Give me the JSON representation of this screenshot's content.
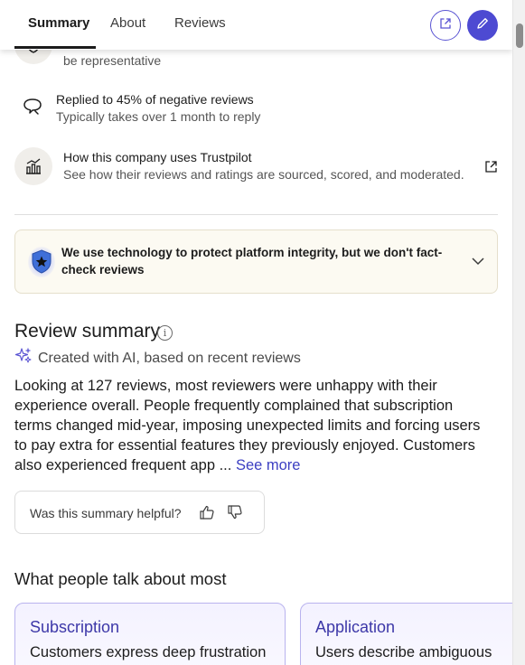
{
  "tabs": [
    {
      "label": "Summary",
      "active": true
    },
    {
      "label": "About",
      "active": false
    },
    {
      "label": "Reviews",
      "active": false
    }
  ],
  "header_actions": [
    {
      "icon": "external-link-icon"
    },
    {
      "icon": "pencil-icon"
    }
  ],
  "trust_rows": [
    {
      "icon": "shield-check-icon",
      "main": "",
      "sub": "be representative"
    },
    {
      "icon": "speech-bubble-icon",
      "main": "Replied to 45% of negative reviews",
      "sub": "Typically takes over 1 month to reply"
    },
    {
      "icon": "bar-chart-icon",
      "main": "How this company uses Trustpilot",
      "sub": "See how their reviews and ratings are sourced, scored, and moderated."
    }
  ],
  "integrity_banner": {
    "text": "We use technology to protect platform integrity, but we don't fact-check reviews",
    "icon": "star-shield-icon"
  },
  "review_summary": {
    "title": "Review summary",
    "info_icon": "i",
    "ai_note": "Created with AI, based on recent reviews",
    "body": "Looking at 127 reviews, most reviewers were unhappy with their experience overall. People frequently complained that subscription terms changed mid-year, imposing unexpected limits and forcing users to pay extra for essential features they previously enjoyed. Customers also experienced frequent app ...",
    "see_more": "See more"
  },
  "helpful": {
    "question": "Was this summary helpful?"
  },
  "topics": {
    "title": "What people talk about most",
    "cards": [
      {
        "title": "Subscription",
        "desc": "Customers express deep frustration"
      },
      {
        "title": "Application",
        "desc": "Users describe ambiguous"
      }
    ]
  },
  "colors": {
    "accent": "#4d4ad2",
    "link": "#3c3fc2",
    "banner_bg": "#fcfaf2",
    "card_border": "#b9b3ee"
  }
}
